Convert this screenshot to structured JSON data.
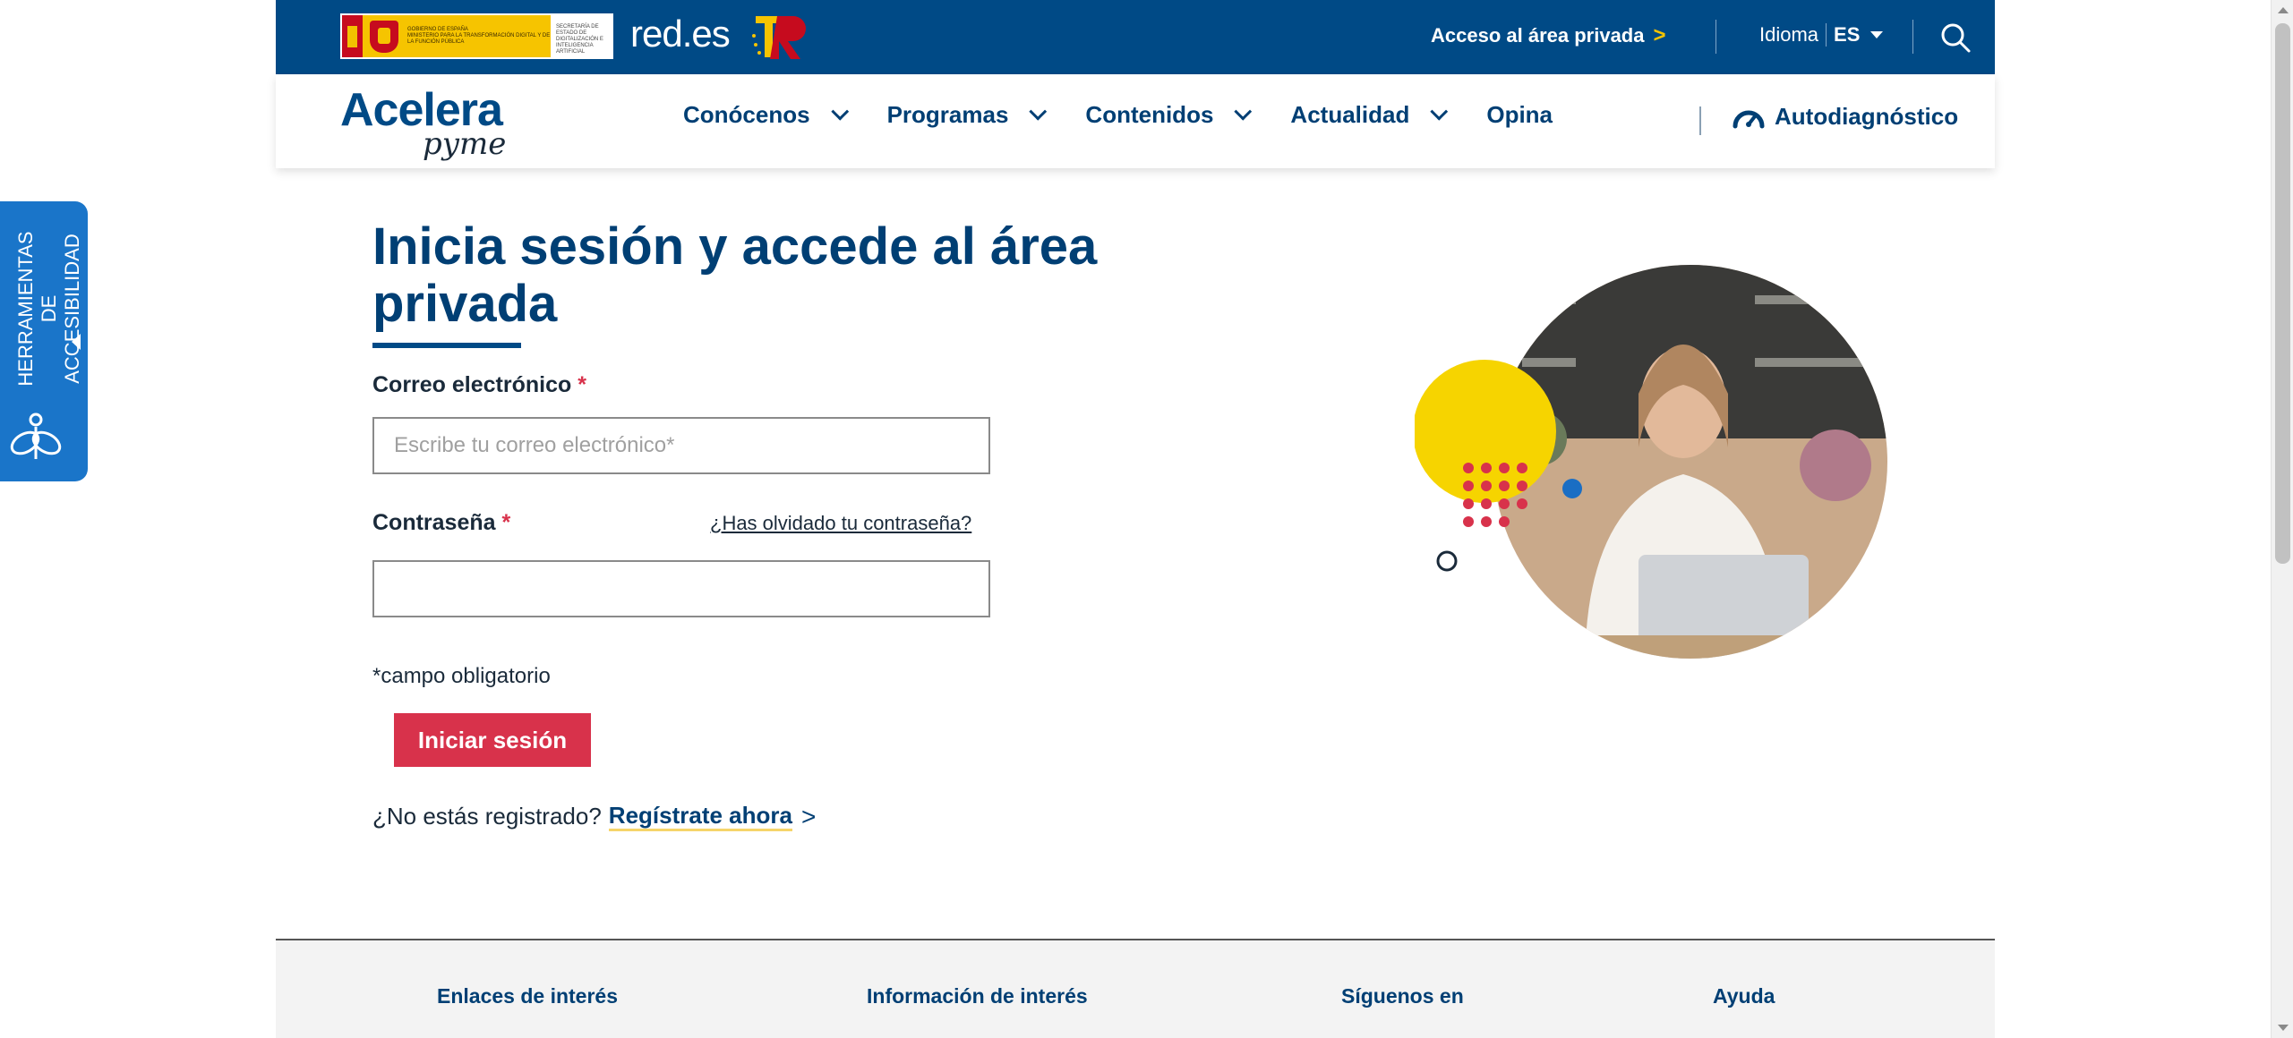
{
  "header": {
    "gov_logo_lines": [
      "GOBIERNO DE ESPAÑA",
      "MINISTERIO PARA LA TRANSFORMACIÓN DIGITAL Y DE LA FUNCIÓN PÚBLICA",
      "SECRETARÍA DE ESTADO DE DIGITALIZACIÓN E INTELIGENCIA ARTIFICIAL"
    ],
    "redes_logo": "red.es",
    "private_area_link": "Acceso al área privada",
    "private_area_arrow": ">",
    "language_label": "Idioma",
    "language_value": "ES",
    "search_icon": "search-icon"
  },
  "nav": {
    "brand_primary": "Acelera",
    "brand_secondary": "pyme",
    "items": [
      {
        "label": "Conócenos",
        "has_dropdown": true
      },
      {
        "label": "Programas",
        "has_dropdown": true
      },
      {
        "label": "Contenidos",
        "has_dropdown": true
      },
      {
        "label": "Actualidad",
        "has_dropdown": true
      },
      {
        "label": "Opina",
        "has_dropdown": false
      }
    ],
    "autodiag_label": "Autodiagnóstico",
    "autodiag_icon": "gauge-icon"
  },
  "accessibility": {
    "line1": "HERRAMIENTAS DE",
    "line2": "ACCESIBILIDAD",
    "icon": "accessibility-icon"
  },
  "login": {
    "title": "Inicia sesión y accede al área privada",
    "email_label": "Correo electrónico",
    "email_placeholder": "Escribe tu correo electrónico*",
    "email_value": "",
    "password_label": "Contraseña",
    "password_value": "",
    "required_mark": "*",
    "forgot_link": "¿Has olvidado tu contraseña?",
    "required_note": "*campo obligatorio",
    "submit_label": "Iniciar sesión",
    "register_prompt": "¿No estás registrado?",
    "register_link": "Regístrate ahora",
    "register_arrow": ">"
  },
  "footer": {
    "columns": [
      "Enlaces de interés",
      "Información de interés",
      "Síguenos en",
      "Ayuda"
    ]
  },
  "colors": {
    "primary_blue": "#004a86",
    "accent_red": "#d8324b",
    "accent_yellow": "#f6c400",
    "a11y_blue": "#1a75c9"
  }
}
